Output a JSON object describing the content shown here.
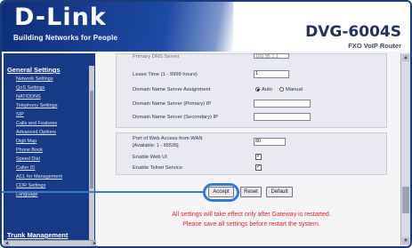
{
  "header": {
    "logo": "D-Link",
    "tagline": "Building Networks for People",
    "model": "DVG-6004S",
    "model_sub": "FXO VoIP Router"
  },
  "sidebar": {
    "heading": "General Settings",
    "items": [
      "Network Settings",
      "QoS Settings",
      "NAT/DDNS",
      "Telephony Settings",
      "SIP",
      "Calls and Features",
      "Advanced Options",
      "Digit Map",
      "Phone Book",
      "Speed Dial",
      "Caller ID",
      "ACL for Management",
      "CDR Settings",
      "Language"
    ],
    "heading2": "Trunk Management"
  },
  "form": {
    "top_cut_label": "Primary DNS Server",
    "top_cut_value": "168.95.1.1",
    "lease_time_label": "Lease Time (1 - 9999 hours)",
    "lease_time_value": "1",
    "dns_assign_label": "Domain Name Server Assignment",
    "dns_auto": "Auto",
    "dns_manual": "Manual",
    "dns_primary_label": "Domain Name Server (Primary) IP",
    "dns_secondary_label": "Domain Name Server (Secondary) IP",
    "web_port_label": "Port of Web Access from WAN",
    "web_port_hint": "[Available: 1 - 65535]",
    "web_port_value": "80",
    "web_ui_label": "Enable Web UI",
    "telnet_label": "Enable Telnet Service",
    "check_mark": "✓"
  },
  "buttons": {
    "accept": "Accept",
    "reset": "Reset",
    "default": "Default"
  },
  "messages": {
    "line1": "All settings will take effect only after Gateway is restarted.",
    "line2": "Please save all settings before restart the system."
  },
  "colors": {
    "sidebar_bg": "#173a87",
    "warning": "#e0242a",
    "highlight": "#3a79c9"
  }
}
